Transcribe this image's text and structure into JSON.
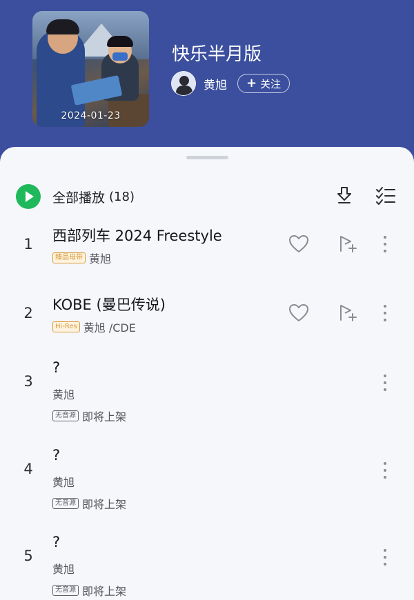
{
  "album": {
    "title": "快乐半月版",
    "release_date": "2024-01-23",
    "artist": "黄旭",
    "follow_label": "关注",
    "follow_plus": "+"
  },
  "play_all": {
    "label": "全部播放",
    "count": "(18)"
  },
  "icons": {
    "play": "play-circle-icon",
    "download": "download-icon",
    "multiselect": "multi-select-list-icon",
    "like": "heart-icon",
    "add_to_playlist": "add-to-playlist-icon",
    "more": "more-vertical-icon"
  },
  "colors": {
    "header_bg": "#3b4f9e",
    "panel_bg": "#f6f7fb",
    "play_green": "#1fb85a",
    "badge_gold": "#d99a3a"
  },
  "songs": [
    {
      "num": "1",
      "title": "西部列车 2024 Freestyle",
      "badge": "臻品母带",
      "artist": "黄旭"
    },
    {
      "num": "2",
      "title": "KOBE (曼巴传说)",
      "badge": "Hi-Res",
      "artist": "黄旭 /CDE"
    },
    {
      "num": "3",
      "title": "?",
      "artist": "黄旭",
      "status_badge": "无音源",
      "status": "即将上架"
    },
    {
      "num": "4",
      "title": "?",
      "artist": "黄旭",
      "status_badge": "无音源",
      "status": "即将上架"
    },
    {
      "num": "5",
      "title": "?",
      "artist": "黄旭",
      "status_badge": "无音源",
      "status": "即将上架"
    }
  ]
}
